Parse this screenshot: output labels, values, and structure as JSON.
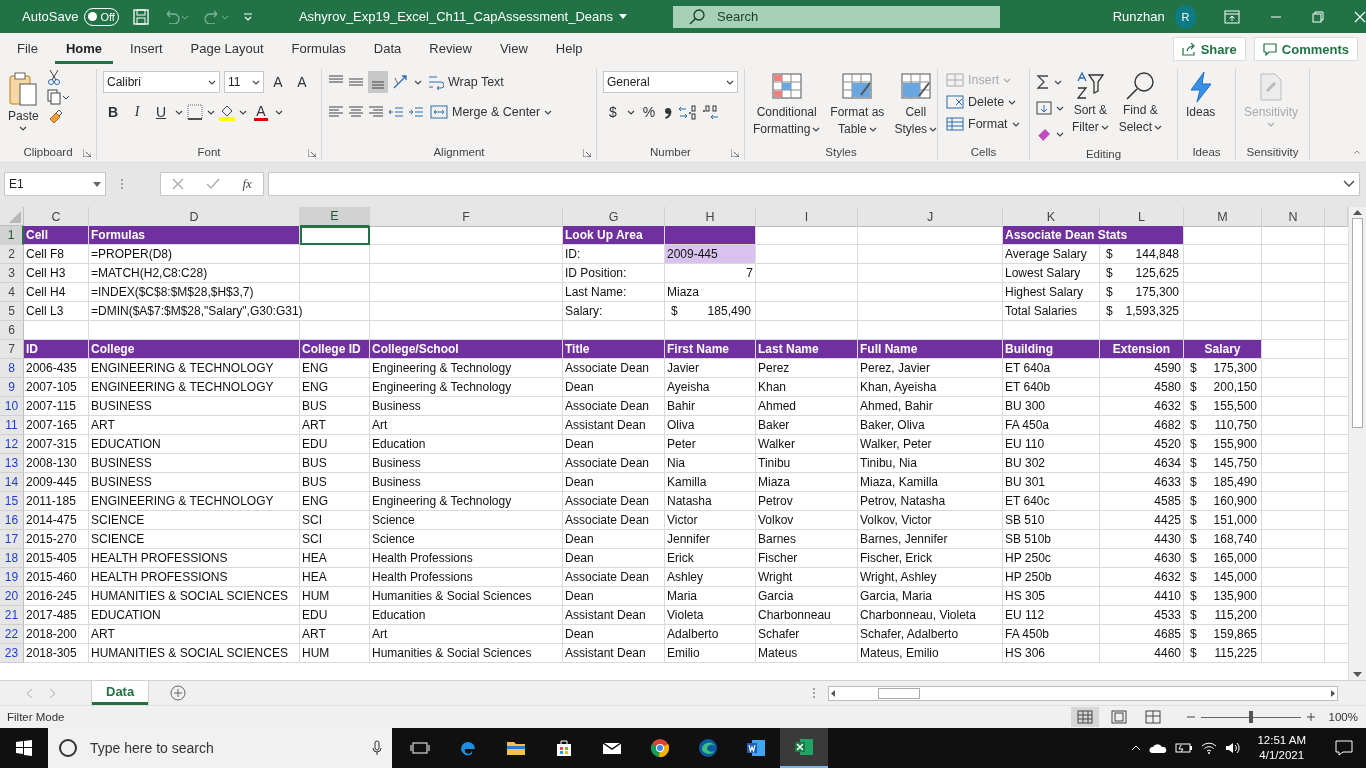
{
  "title_bar": {
    "autosave_label": "AutoSave",
    "autosave": {
      "label": "Off",
      "on": false
    },
    "file_name": "Ashyrov_Exp19_Excel_Ch11_CapAssessment_Deans",
    "search": {
      "placeholder": "Search"
    },
    "user": "Runzhan",
    "avatar": "R"
  },
  "menu_tabs": [
    {
      "label": "File",
      "selected": false
    },
    {
      "label": "Home",
      "selected": true
    },
    {
      "label": "Insert",
      "selected": false
    },
    {
      "label": "Page Layout",
      "selected": false
    },
    {
      "label": "Formulas",
      "selected": false
    },
    {
      "label": "Data",
      "selected": false
    },
    {
      "label": "Review",
      "selected": false
    },
    {
      "label": "View",
      "selected": false
    },
    {
      "label": "Help",
      "selected": false
    }
  ],
  "share": "Share",
  "comments": "Comments",
  "ribbon": {
    "clipboard": {
      "paste": "Paste",
      "group": "Clipboard"
    },
    "font": {
      "font_name": "Calibri",
      "font_size": "11",
      "grow": "A",
      "shrink": "A",
      "bold": "B",
      "italic": "I",
      "underline": "U",
      "font_color": "A",
      "group": "Font"
    },
    "alignment": {
      "wrap_text": "Wrap Text",
      "merge_center": "Merge & Center",
      "group": "Alignment"
    },
    "number": {
      "format": "General",
      "currency": "$",
      "percent": "%",
      "group": "Number"
    },
    "styles": {
      "conditional": [
        "Conditional",
        "Formatting"
      ],
      "format_table": [
        "Format as",
        "Table"
      ],
      "cell_styles": [
        "Cell",
        "Styles"
      ],
      "group": "Styles"
    },
    "cells": {
      "insert": {
        "label": "Insert",
        "disabled": true
      },
      "delete": {
        "label": "Delete",
        "disabled": false
      },
      "format": {
        "label": "Format",
        "disabled": false
      },
      "group": "Cells"
    },
    "editing": {
      "sort": [
        "Sort &",
        "Filter"
      ],
      "find": [
        "Find &",
        "Select"
      ],
      "group": "Editing"
    },
    "ideas": {
      "label": "Ideas",
      "group": "Ideas"
    },
    "sensitivity": {
      "label": "Sensitivity",
      "disabled": true,
      "group": "Sensitivity"
    }
  },
  "formula_bar": {
    "name_box": "E1",
    "function_label": "fx"
  },
  "columns": [
    {
      "label": "C",
      "selected": false
    },
    {
      "label": "D",
      "selected": false
    },
    {
      "label": "E",
      "selected": true
    },
    {
      "label": "F",
      "selected": false
    },
    {
      "label": "G",
      "selected": false
    },
    {
      "label": "H",
      "selected": false
    },
    {
      "label": "I",
      "selected": false
    },
    {
      "label": "J",
      "selected": false
    },
    {
      "label": "K",
      "selected": false
    },
    {
      "label": "L",
      "selected": false
    },
    {
      "label": "M",
      "selected": false
    },
    {
      "label": "N",
      "selected": false
    }
  ],
  "rows": [
    {
      "number": "1",
      "selected": true,
      "filtered": false,
      "cells": [
        {
          "text": "Cell",
          "kind": "header"
        },
        {
          "text": "Formulas",
          "kind": "header"
        },
        null,
        null,
        {
          "text": "Look Up Area",
          "kind": "header"
        },
        {
          "kind": "header"
        },
        null,
        null,
        {
          "text": "Associate Dean Stats",
          "kind": "header"
        },
        {
          "kind": "header"
        }
      ]
    },
    {
      "number": "2",
      "selected": false,
      "filtered": false,
      "cells": [
        "Cell F8",
        "=PROPER(D8)",
        null,
        null,
        "ID:",
        {
          "text": "2009-445",
          "kind": "highlight"
        },
        null,
        null,
        "Average Salary",
        {
          "kind": "money",
          "currency": "$",
          "amount": "144,848"
        }
      ]
    },
    {
      "number": "3",
      "selected": false,
      "filtered": false,
      "cells": [
        "Cell H3",
        "=MATCH(H2,C8:C28)",
        null,
        null,
        "ID Position:",
        {
          "text": "7",
          "kind": "number"
        },
        null,
        null,
        "Lowest Salary",
        {
          "kind": "money",
          "currency": "$",
          "amount": "125,625"
        }
      ]
    },
    {
      "number": "4",
      "selected": false,
      "filtered": false,
      "cells": [
        "Cell H4",
        "=INDEX($C$8:$M$28,$H$3,7)",
        null,
        null,
        "Last Name:",
        "Miaza",
        null,
        null,
        "Highest Salary",
        {
          "kind": "money",
          "currency": "$",
          "amount": "175,300"
        }
      ]
    },
    {
      "number": "5",
      "selected": false,
      "filtered": false,
      "cells": [
        "Cell L3",
        "=DMIN($A$7:$M$28,\"Salary\",G30:G31)",
        null,
        null,
        "Salary:",
        {
          "kind": "money",
          "currency": "$",
          "amount": "185,490"
        },
        null,
        null,
        "Total Salaries",
        {
          "kind": "money",
          "currency": "$",
          "amount": "1,593,325"
        }
      ]
    },
    {
      "number": "6",
      "selected": false,
      "filtered": false
    },
    {
      "number": "7",
      "selected": false,
      "filtered": false,
      "cells": [
        {
          "text": "ID",
          "kind": "header"
        },
        {
          "text": "College",
          "kind": "header"
        },
        {
          "text": "College ID",
          "kind": "header"
        },
        {
          "text": "College/School",
          "kind": "header"
        },
        {
          "text": "Title",
          "kind": "header"
        },
        {
          "text": "First Name",
          "kind": "header"
        },
        {
          "text": "Last Name",
          "kind": "header"
        },
        {
          "text": "Full Name",
          "kind": "header"
        },
        {
          "text": "Building",
          "kind": "header"
        },
        {
          "text": "Extension",
          "kind": "header_centered"
        },
        {
          "text": "Salary",
          "kind": "header_centered"
        }
      ]
    },
    {
      "number": "8",
      "selected": false,
      "filtered": true,
      "cells": [
        "2006-435",
        "ENGINEERING & TECHNOLOGY",
        "ENG",
        "Engineering & Technology",
        "Associate Dean",
        "Javier",
        "Perez",
        "Perez, Javier",
        "ET 640a",
        {
          "text": "4590",
          "kind": "number"
        },
        {
          "kind": "money",
          "currency": "$",
          "amount": "175,300"
        }
      ]
    },
    {
      "number": "9",
      "selected": false,
      "filtered": true,
      "cells": [
        "2007-105",
        "ENGINEERING & TECHNOLOGY",
        "ENG",
        "Engineering & Technology",
        "Dean",
        "Ayeisha",
        "Khan",
        "Khan, Ayeisha",
        "ET 640b",
        {
          "text": "4580",
          "kind": "number"
        },
        {
          "kind": "money",
          "currency": "$",
          "amount": "200,150"
        }
      ]
    },
    {
      "number": "10",
      "selected": false,
      "filtered": true,
      "cells": [
        "2007-115",
        "BUSINESS",
        "BUS",
        "Business",
        "Associate Dean",
        "Bahir",
        "Ahmed",
        "Ahmed, Bahir",
        "BU 300",
        {
          "text": "4632",
          "kind": "number"
        },
        {
          "kind": "money",
          "currency": "$",
          "amount": "155,500"
        }
      ]
    },
    {
      "number": "11",
      "selected": false,
      "filtered": true,
      "cells": [
        "2007-165",
        "ART",
        "ART",
        "Art",
        "Assistant Dean",
        "Oliva",
        "Baker",
        "Baker, Oliva",
        "FA 450a",
        {
          "text": "4682",
          "kind": "number"
        },
        {
          "kind": "money",
          "currency": "$",
          "amount": "110,750"
        }
      ]
    },
    {
      "number": "12",
      "selected": false,
      "filtered": true,
      "cells": [
        "2007-315",
        "EDUCATION",
        "EDU",
        "Education",
        "Dean",
        "Peter",
        "Walker",
        "Walker, Peter",
        "EU 110",
        {
          "text": "4520",
          "kind": "number"
        },
        {
          "kind": "money",
          "currency": "$",
          "amount": "155,900"
        }
      ]
    },
    {
      "number": "13",
      "selected": false,
      "filtered": true,
      "cells": [
        "2008-130",
        "BUSINESS",
        "BUS",
        "Business",
        "Associate Dean",
        "Nia",
        "Tinibu",
        "Tinibu, Nia",
        "BU 302",
        {
          "text": "4634",
          "kind": "number"
        },
        {
          "kind": "money",
          "currency": "$",
          "amount": "145,750"
        }
      ]
    },
    {
      "number": "14",
      "selected": false,
      "filtered": true,
      "cells": [
        "2009-445",
        "BUSINESS",
        "BUS",
        "Business",
        "Dean",
        "Kamilla",
        "Miaza",
        "Miaza, Kamilla",
        "BU 301",
        {
          "text": "4633",
          "kind": "number"
        },
        {
          "kind": "money",
          "currency": "$",
          "amount": "185,490"
        }
      ]
    },
    {
      "number": "15",
      "selected": false,
      "filtered": true,
      "cells": [
        "2011-185",
        "ENGINEERING & TECHNOLOGY",
        "ENG",
        "Engineering & Technology",
        "Associate Dean",
        "Natasha",
        "Petrov",
        "Petrov, Natasha",
        "ET 640c",
        {
          "text": "4585",
          "kind": "number"
        },
        {
          "kind": "money",
          "currency": "$",
          "amount": "160,900"
        }
      ]
    },
    {
      "number": "16",
      "selected": false,
      "filtered": true,
      "cells": [
        "2014-475",
        "SCIENCE",
        "SCI",
        "Science",
        "Associate Dean",
        "Victor",
        "Volkov",
        "Volkov, Victor",
        "SB 510",
        {
          "text": "4425",
          "kind": "number"
        },
        {
          "kind": "money",
          "currency": "$",
          "amount": "151,000"
        }
      ]
    },
    {
      "number": "17",
      "selected": false,
      "filtered": true,
      "cells": [
        "2015-270",
        "SCIENCE",
        "SCI",
        "Science",
        "Dean",
        "Jennifer",
        "Barnes",
        "Barnes, Jennifer",
        "SB 510b",
        {
          "text": "4430",
          "kind": "number"
        },
        {
          "kind": "money",
          "currency": "$",
          "amount": "168,740"
        }
      ]
    },
    {
      "number": "18",
      "selected": false,
      "filtered": true,
      "cells": [
        "2015-405",
        "HEALTH PROFESSIONS",
        "HEA",
        "Health Professions",
        "Dean",
        "Erick",
        "Fischer",
        "Fischer, Erick",
        "HP 250c",
        {
          "text": "4630",
          "kind": "number"
        },
        {
          "kind": "money",
          "currency": "$",
          "amount": "165,000"
        }
      ]
    },
    {
      "number": "19",
      "selected": false,
      "filtered": true,
      "cells": [
        "2015-460",
        "HEALTH PROFESSIONS",
        "HEA",
        "Health Professions",
        "Associate Dean",
        "Ashley",
        "Wright",
        "Wright, Ashley",
        "HP 250b",
        {
          "text": "4632",
          "kind": "number"
        },
        {
          "kind": "money",
          "currency": "$",
          "amount": "145,000"
        }
      ]
    },
    {
      "number": "20",
      "selected": false,
      "filtered": true,
      "cells": [
        "2016-245",
        "HUMANITIES & SOCIAL SCIENCES",
        "HUM",
        "Humanities & Social Sciences",
        "Dean",
        "Maria",
        "Garcia",
        "Garcia, Maria",
        "HS 305",
        {
          "text": "4410",
          "kind": "number"
        },
        {
          "kind": "money",
          "currency": "$",
          "amount": "135,900"
        }
      ]
    },
    {
      "number": "21",
      "selected": false,
      "filtered": true,
      "cells": [
        "2017-485",
        "EDUCATION",
        "EDU",
        "Education",
        "Assistant Dean",
        "Violeta",
        "Charbonneau",
        "Charbonneau, Violeta",
        "EU 112",
        {
          "text": "4533",
          "kind": "number"
        },
        {
          "kind": "money",
          "currency": "$",
          "amount": "115,200"
        }
      ]
    },
    {
      "number": "22",
      "selected": false,
      "filtered": true,
      "cells": [
        "2018-200",
        "ART",
        "ART",
        "Art",
        "Dean",
        "Adalberto",
        "Schafer",
        "Schafer, Adalberto",
        "FA 450b",
        {
          "text": "4685",
          "kind": "number"
        },
        {
          "kind": "money",
          "currency": "$",
          "amount": "159,865"
        }
      ]
    },
    {
      "number": "23",
      "selected": false,
      "filtered": true,
      "cells": [
        "2018-305",
        "HUMANITIES & SOCIAL SCIENCES",
        "HUM",
        "Humanities & Social Sciences",
        "Assistant Dean",
        "Emilio",
        "Mateus",
        "Mateus, Emilio",
        "HS 306",
        {
          "text": "4460",
          "kind": "number"
        },
        {
          "kind": "money",
          "currency": "$",
          "amount": "115,225"
        }
      ]
    }
  ],
  "sheet_tabs": [
    {
      "label": "Data",
      "selected": true
    }
  ],
  "status_bar": {
    "mode": "Filter Mode",
    "views": [
      {
        "selected": true
      },
      {
        "selected": false
      },
      {
        "selected": false
      }
    ],
    "zoom": {
      "level": 0.5
    },
    "zoom_label": "100%"
  },
  "taskbar": {
    "search": {
      "placeholder": "Type here to search"
    },
    "apps": [
      {
        "active": false
      },
      {
        "active": false
      },
      {
        "active": false
      },
      {
        "active": false
      },
      {
        "active": false
      },
      {
        "active": false
      },
      {
        "active": false
      },
      {
        "active": false
      },
      {
        "active": true
      }
    ],
    "time": "12:51 AM",
    "date": "4/1/2021"
  }
}
